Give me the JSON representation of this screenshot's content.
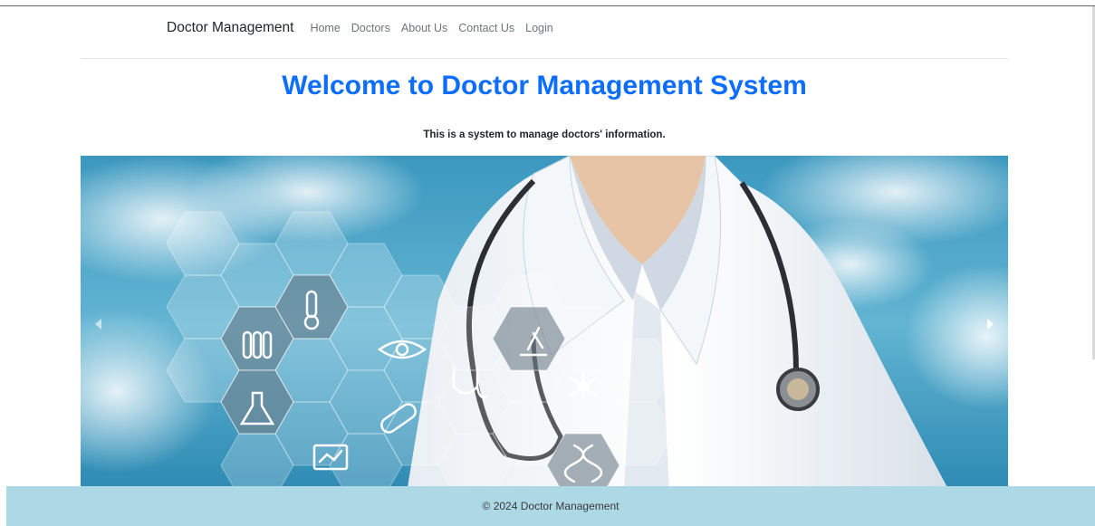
{
  "navbar": {
    "brand": "Doctor Management",
    "links": [
      "Home",
      "Doctors",
      "About Us",
      "Contact Us",
      "Login"
    ]
  },
  "hero": {
    "title": "Welcome to Doctor Management System",
    "subtitle": "This is a system to manage doctors' information."
  },
  "carousel": {
    "image": "doctor-with-stethoscope-and-medical-hexagon-icons",
    "icons": [
      "thermometer-icon",
      "test-tubes-icon",
      "eye-icon",
      "microscope-icon",
      "stethoscope-icon",
      "molecule-icon",
      "flask-icon",
      "pill-icon",
      "dna-icon",
      "monitor-chart-icon"
    ]
  },
  "footer": {
    "text": "© 2024 Doctor Management"
  },
  "colors": {
    "accent": "#0d6efd",
    "footer_bg": "#add8e6"
  }
}
